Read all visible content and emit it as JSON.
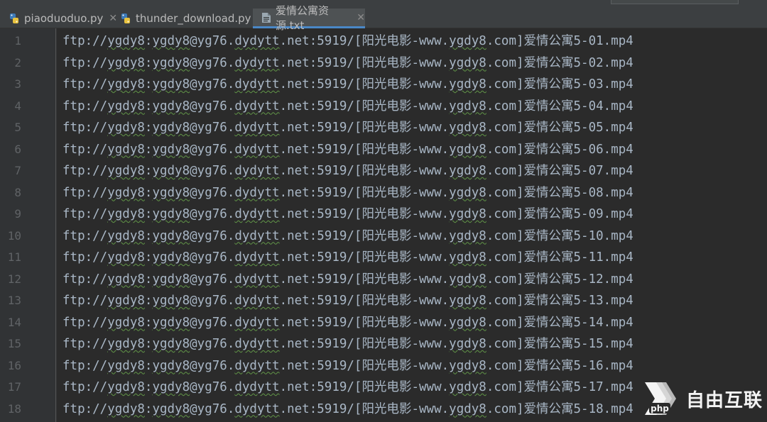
{
  "tabs": [
    {
      "label": "piaoduoduo.py",
      "icon": "python-file-icon",
      "active": false
    },
    {
      "label": "thunder_download.py",
      "icon": "python-file-icon",
      "active": false
    },
    {
      "label": "爱情公寓资源.txt",
      "icon": "text-file-icon",
      "active": true
    }
  ],
  "editor": {
    "lines": [
      {
        "num": "1",
        "pre": "ftp://",
        "w": "ygdy8",
        "mid1": ":",
        "w2": "ygdy8",
        "mid2": "@yg76.",
        "w3": "dydytt",
        "mid3": ".net:5919/[阳光电影-www.",
        "w4": "ygdy8",
        "tail": ".com]爱情公寓5-01.mp4"
      },
      {
        "num": "2",
        "pre": "ftp://",
        "w": "ygdy8",
        "mid1": ":",
        "w2": "ygdy8",
        "mid2": "@yg76.",
        "w3": "dydytt",
        "mid3": ".net:5919/[阳光电影-www.",
        "w4": "ygdy8",
        "tail": ".com]爱情公寓5-02.mp4"
      },
      {
        "num": "3",
        "pre": "ftp://",
        "w": "ygdy8",
        "mid1": ":",
        "w2": "ygdy8",
        "mid2": "@yg76.",
        "w3": "dydytt",
        "mid3": ".net:5919/[阳光电影-www.",
        "w4": "ygdy8",
        "tail": ".com]爱情公寓5-03.mp4"
      },
      {
        "num": "4",
        "pre": "ftp://",
        "w": "ygdy8",
        "mid1": ":",
        "w2": "ygdy8",
        "mid2": "@yg76.",
        "w3": "dydytt",
        "mid3": ".net:5919/[阳光电影-www.",
        "w4": "ygdy8",
        "tail": ".com]爱情公寓5-04.mp4"
      },
      {
        "num": "5",
        "pre": "ftp://",
        "w": "ygdy8",
        "mid1": ":",
        "w2": "ygdy8",
        "mid2": "@yg76.",
        "w3": "dydytt",
        "mid3": ".net:5919/[阳光电影-www.",
        "w4": "ygdy8",
        "tail": ".com]爱情公寓5-05.mp4"
      },
      {
        "num": "6",
        "pre": "ftp://",
        "w": "ygdy8",
        "mid1": ":",
        "w2": "ygdy8",
        "mid2": "@yg76.",
        "w3": "dydytt",
        "mid3": ".net:5919/[阳光电影-www.",
        "w4": "ygdy8",
        "tail": ".com]爱情公寓5-06.mp4"
      },
      {
        "num": "7",
        "pre": "ftp://",
        "w": "ygdy8",
        "mid1": ":",
        "w2": "ygdy8",
        "mid2": "@yg76.",
        "w3": "dydytt",
        "mid3": ".net:5919/[阳光电影-www.",
        "w4": "ygdy8",
        "tail": ".com]爱情公寓5-07.mp4"
      },
      {
        "num": "8",
        "pre": "ftp://",
        "w": "ygdy8",
        "mid1": ":",
        "w2": "ygdy8",
        "mid2": "@yg76.",
        "w3": "dydytt",
        "mid3": ".net:5919/[阳光电影-www.",
        "w4": "ygdy8",
        "tail": ".com]爱情公寓5-08.mp4"
      },
      {
        "num": "9",
        "pre": "ftp://",
        "w": "ygdy8",
        "mid1": ":",
        "w2": "ygdy8",
        "mid2": "@yg76.",
        "w3": "dydytt",
        "mid3": ".net:5919/[阳光电影-www.",
        "w4": "ygdy8",
        "tail": ".com]爱情公寓5-09.mp4"
      },
      {
        "num": "10",
        "pre": "ftp://",
        "w": "ygdy8",
        "mid1": ":",
        "w2": "ygdy8",
        "mid2": "@yg76.",
        "w3": "dydytt",
        "mid3": ".net:5919/[阳光电影-www.",
        "w4": "ygdy8",
        "tail": ".com]爱情公寓5-10.mp4"
      },
      {
        "num": "11",
        "pre": "ftp://",
        "w": "ygdy8",
        "mid1": ":",
        "w2": "ygdy8",
        "mid2": "@yg76.",
        "w3": "dydytt",
        "mid3": ".net:5919/[阳光电影-www.",
        "w4": "ygdy8",
        "tail": ".com]爱情公寓5-11.mp4"
      },
      {
        "num": "12",
        "pre": "ftp://",
        "w": "ygdy8",
        "mid1": ":",
        "w2": "ygdy8",
        "mid2": "@yg76.",
        "w3": "dydytt",
        "mid3": ".net:5919/[阳光电影-www.",
        "w4": "ygdy8",
        "tail": ".com]爱情公寓5-12.mp4"
      },
      {
        "num": "13",
        "pre": "ftp://",
        "w": "ygdy8",
        "mid1": ":",
        "w2": "ygdy8",
        "mid2": "@yg76.",
        "w3": "dydytt",
        "mid3": ".net:5919/[阳光电影-www.",
        "w4": "ygdy8",
        "tail": ".com]爱情公寓5-13.mp4"
      },
      {
        "num": "14",
        "pre": "ftp://",
        "w": "ygdy8",
        "mid1": ":",
        "w2": "ygdy8",
        "mid2": "@yg76.",
        "w3": "dydytt",
        "mid3": ".net:5919/[阳光电影-www.",
        "w4": "ygdy8",
        "tail": ".com]爱情公寓5-14.mp4"
      },
      {
        "num": "15",
        "pre": "ftp://",
        "w": "ygdy8",
        "mid1": ":",
        "w2": "ygdy8",
        "mid2": "@yg76.",
        "w3": "dydytt",
        "mid3": ".net:5919/[阳光电影-www.",
        "w4": "ygdy8",
        "tail": ".com]爱情公寓5-15.mp4"
      },
      {
        "num": "16",
        "pre": "ftp://",
        "w": "ygdy8",
        "mid1": ":",
        "w2": "ygdy8",
        "mid2": "@yg76.",
        "w3": "dydytt",
        "mid3": ".net:5919/[阳光电影-www.",
        "w4": "ygdy8",
        "tail": ".com]爱情公寓5-16.mp4"
      },
      {
        "num": "17",
        "pre": "ftp://",
        "w": "ygdy8",
        "mid1": ":",
        "w2": "ygdy8",
        "mid2": "@yg76.",
        "w3": "dydytt",
        "mid3": ".net:5919/[阳光电影-www.",
        "w4": "ygdy8",
        "tail": ".com]爱情公寓5-17.mp4"
      },
      {
        "num": "18",
        "pre": "ftp://",
        "w": "ygdy8",
        "mid1": ":",
        "w2": "ygdy8",
        "mid2": "@yg76.",
        "w3": "dydytt",
        "mid3": ".net:5919/[阳光电影-www.",
        "w4": "ygdy8",
        "tail": ".com]爱情公寓5-18.mp4"
      }
    ]
  },
  "watermark": {
    "logo_text": "php",
    "text": "自由互联"
  },
  "colors": {
    "editor_bg": "#2b2b2b",
    "gutter_bg": "#313335",
    "tabbar_bg": "#3c3f41",
    "text": "#a9b7c6",
    "line_number": "#606366",
    "active_tab_underline": "#4a88c7",
    "typo_underline": "#619647"
  }
}
